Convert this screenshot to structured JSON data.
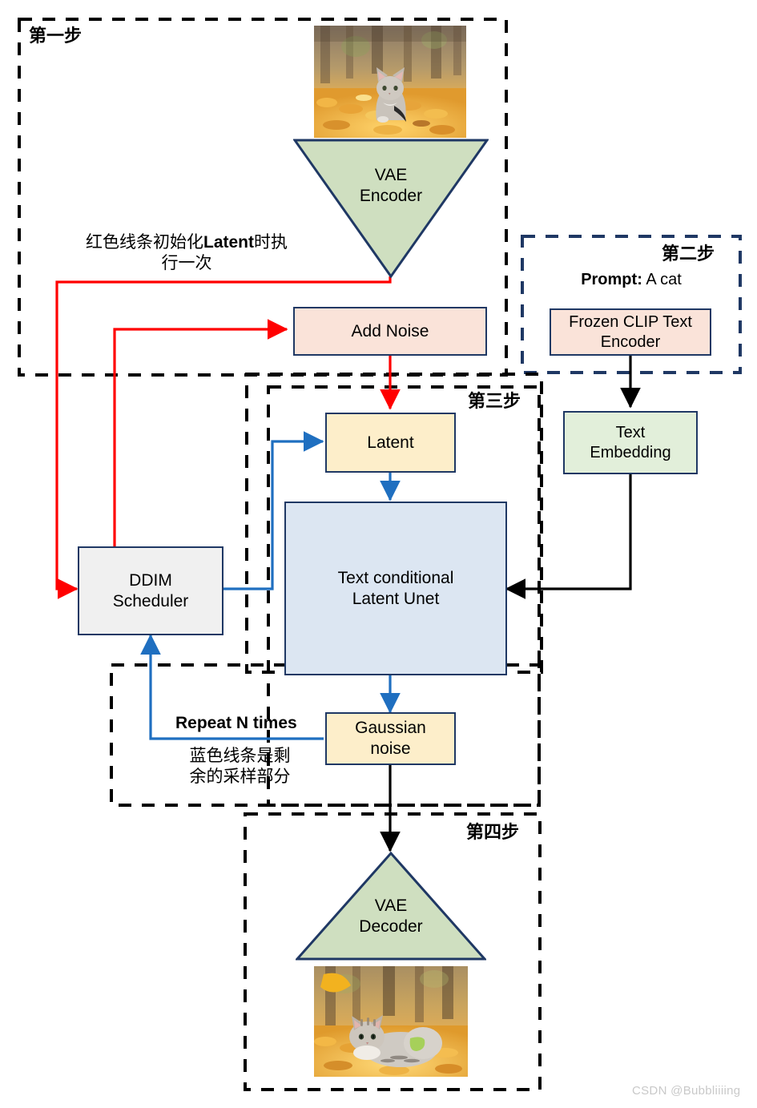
{
  "title": "Stable Diffusion img2img pipeline diagram",
  "steps": {
    "step1_label": "第一步",
    "step2_label": "第二步",
    "step3_label": "第三步",
    "step4_label": "第四步"
  },
  "nodes": {
    "vae_encoder": "VAE\nEncoder",
    "vae_encoder_line1": "VAE",
    "vae_encoder_line2": "Encoder",
    "add_noise": "Add Noise",
    "frozen_clip_line1": "Frozen CLIP Text",
    "frozen_clip_line2": "Encoder",
    "text_embedding_line1": "Text",
    "text_embedding_line2": "Embedding",
    "latent": "Latent",
    "ddim_line1": "DDIM",
    "ddim_line2": "Scheduler",
    "unet_line1": "Text conditional",
    "unet_line2": "Latent Unet",
    "gaussian_line1": "Gaussian",
    "gaussian_line2": "noise",
    "vae_decoder_line1": "VAE",
    "vae_decoder_line2": "Decoder"
  },
  "annotations": {
    "red_note_line1_a": "红色线条初始化",
    "red_note_line1_b": "Latent",
    "red_note_line1_c": "时执",
    "red_note_line2": "行一次",
    "repeat_label": "Repeat N times",
    "blue_note_line1": "蓝色线条是剩",
    "blue_note_line2": "余的采样部分",
    "prompt_key": "Prompt:",
    "prompt_value": " A cat"
  },
  "images": {
    "input_photo_alt": "cat sitting in autumn leaves",
    "output_photo_alt": "cat lying in autumn leaves"
  },
  "watermark": "CSDN @Bubbliiiing",
  "colors": {
    "border": "#1f3864",
    "red_flow": "#ff0000",
    "blue_flow": "#1f6fc0",
    "black_flow": "#000000",
    "peach_fill": "#fae3d9",
    "cream_fill": "#fdeeca",
    "green_fill": "#e2efda",
    "gray_fill": "#f0f0f0",
    "blue_fill": "#dce6f2",
    "dash_stroke": "#000000"
  }
}
